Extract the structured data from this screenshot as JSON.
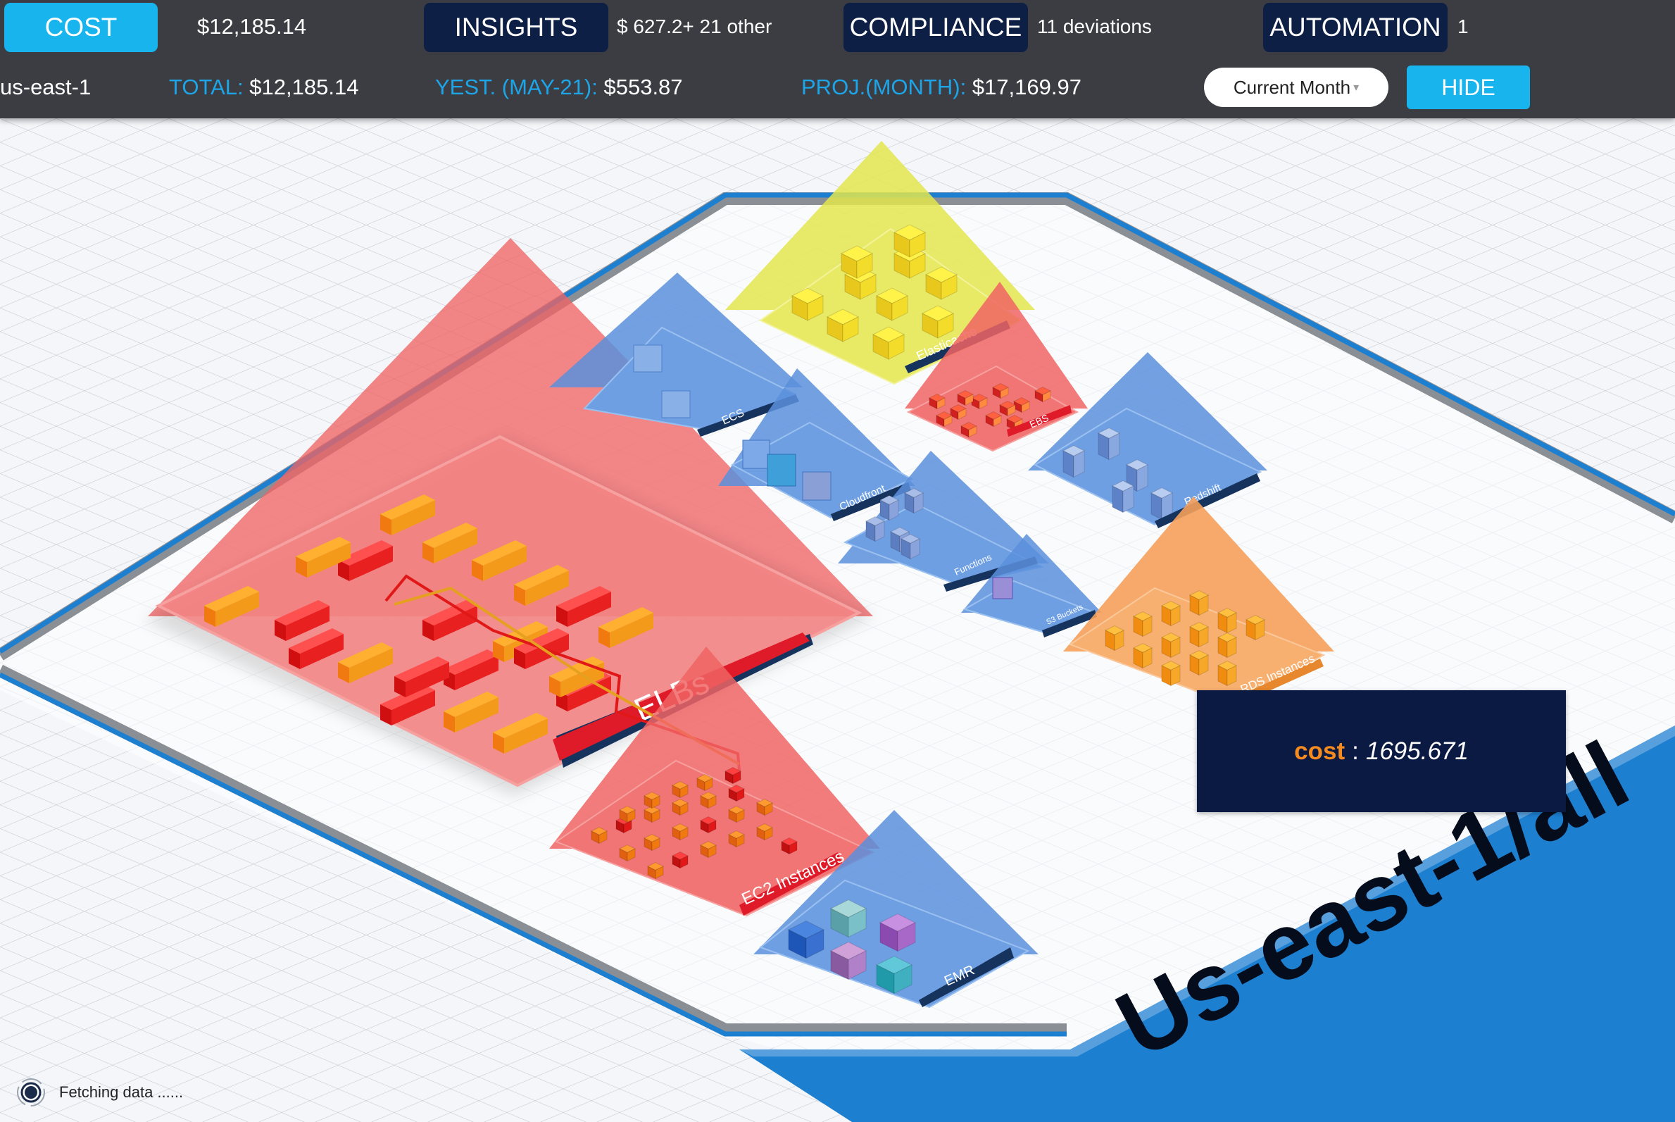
{
  "topbar": {
    "tabs": [
      {
        "label": "COST",
        "info": "$12,185.14",
        "active": true
      },
      {
        "label": "INSIGHTS",
        "info": "$ 627.2+ 21 other",
        "active": false
      },
      {
        "label": "COMPLIANCE",
        "info": "11 deviations",
        "active": false
      },
      {
        "label": "AUTOMATION",
        "info": "1",
        "active": false
      }
    ],
    "region": "us-east-1",
    "total_label": "TOTAL:",
    "total_value": "$12,185.14",
    "yest_label": "YEST. (MAY-21):",
    "yest_value": "$553.87",
    "proj_label": "PROJ.(MONTH):",
    "proj_value": "$17,169.97",
    "period_select": "Current Month",
    "hide_label": "HIDE"
  },
  "scene": {
    "region_banner": "Us-east-1/all",
    "groups": [
      {
        "id": "elbs",
        "label": "ELBs",
        "color": "#f06464"
      },
      {
        "id": "ec2",
        "label": "EC2 Instances",
        "color": "#f06464"
      },
      {
        "id": "ecs",
        "label": "ECS",
        "color": "#5b8fdc"
      },
      {
        "id": "elasticache",
        "label": "Elasticache",
        "color": "#e3e64d"
      },
      {
        "id": "ebs",
        "label": "EBS",
        "color": "#f06464"
      },
      {
        "id": "cloudfront",
        "label": "Cloudfront",
        "color": "#5b8fdc"
      },
      {
        "id": "redshift",
        "label": "Redshift",
        "color": "#5b8fdc"
      },
      {
        "id": "functions",
        "label": "Functions",
        "color": "#5b8fdc"
      },
      {
        "id": "s3",
        "label": "S3 Buckets",
        "color": "#5b8fdc"
      },
      {
        "id": "rds",
        "label": "RDS Instances",
        "color": "#f5a05a"
      },
      {
        "id": "emr",
        "label": "EMR",
        "color": "#5b8fdc"
      }
    ]
  },
  "tooltip": {
    "key": "cost",
    "separator": ":",
    "value": "1695.671"
  },
  "status": {
    "text": "Fetching data ......"
  }
}
